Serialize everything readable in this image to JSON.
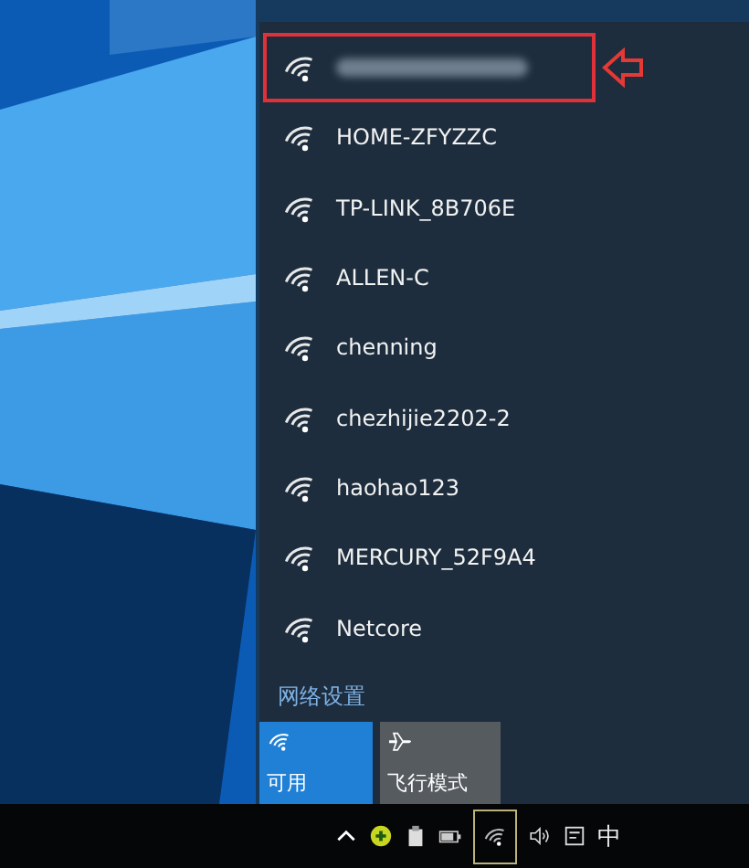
{
  "networks": [
    {
      "kind": "blurred",
      "highlighted": true
    },
    {
      "kind": "named",
      "name": "HOME-ZFYZZC",
      "highlighted": false
    },
    {
      "kind": "named",
      "name": "TP-LINK_8B706E",
      "highlighted": false
    },
    {
      "kind": "named",
      "name": "ALLEN-C",
      "highlighted": false
    },
    {
      "kind": "named",
      "name": "chenning",
      "highlighted": false
    },
    {
      "kind": "named",
      "name": "chezhijie2202-2",
      "highlighted": false
    },
    {
      "kind": "named",
      "name": "haohao123",
      "highlighted": false
    },
    {
      "kind": "named",
      "name": "MERCURY_52F9A4",
      "highlighted": false
    },
    {
      "kind": "named",
      "name": "Netcore",
      "highlighted": false
    }
  ],
  "settings_link": "网络设置",
  "tiles": [
    {
      "kind": "wifi",
      "label": "可用",
      "on": true
    },
    {
      "kind": "airplane",
      "label": "飞行模式",
      "on": false
    }
  ],
  "taskbar": {
    "ime": "中",
    "wifi_highlighted": true
  }
}
